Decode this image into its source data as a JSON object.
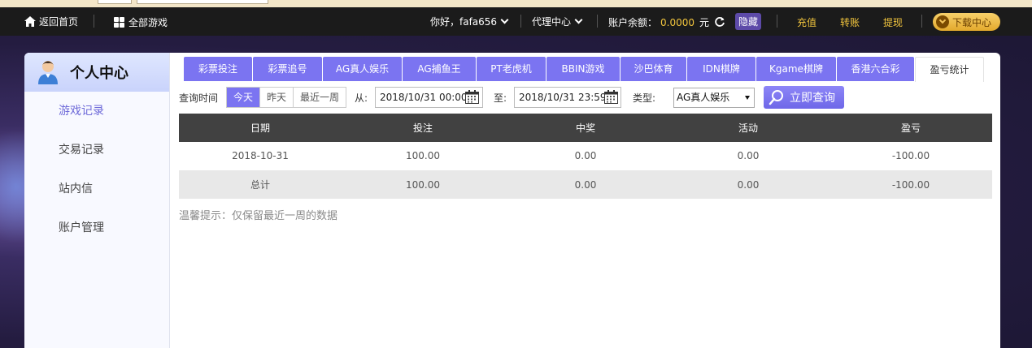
{
  "header": {
    "home_label": "返回首页",
    "all_games_label": "全部游戏",
    "greeting": "你好，fafa656",
    "agent_center": "代理中心",
    "balance_label": "账户余额：",
    "balance_value": "0.0000",
    "currency": "元",
    "hide_label": "隐藏",
    "deposit": "充值",
    "transfer": "转账",
    "withdraw": "提现",
    "download_center": "下载中心"
  },
  "sidebar": {
    "title": "个人中心",
    "items": [
      {
        "label": "游戏记录",
        "active": true
      },
      {
        "label": "交易记录",
        "active": false
      },
      {
        "label": "站内信",
        "active": false
      },
      {
        "label": "账户管理",
        "active": false
      }
    ]
  },
  "tabs": [
    {
      "label": "彩票投注"
    },
    {
      "label": "彩票追号"
    },
    {
      "label": "AG真人娱乐"
    },
    {
      "label": "AG捕鱼王"
    },
    {
      "label": "PT老虎机"
    },
    {
      "label": "BBIN游戏"
    },
    {
      "label": "沙巴体育"
    },
    {
      "label": "IDN棋牌"
    },
    {
      "label": "Kgame棋牌"
    },
    {
      "label": "香港六合彩"
    },
    {
      "label": "盈亏统计",
      "active": true
    }
  ],
  "query": {
    "time_label": "查询时间",
    "periods": [
      "今天",
      "昨天",
      "最近一周"
    ],
    "selected_period": "今天",
    "from_label": "从:",
    "from_value": "2018/10/31 00:00",
    "to_label": "至:",
    "to_value": "2018/10/31 23:59",
    "type_label": "类型:",
    "type_value": "AG真人娱乐",
    "search_button": "立即查询"
  },
  "table": {
    "columns": [
      "日期",
      "投注",
      "中奖",
      "活动",
      "盈亏"
    ],
    "rows": [
      [
        "2018-10-31",
        "100.00",
        "0.00",
        "0.00",
        "-100.00"
      ]
    ],
    "total": [
      "总计",
      "100.00",
      "0.00",
      "0.00",
      "-100.00"
    ]
  },
  "tip": "温馨提示：仅保留最近一周的数据",
  "colors": {
    "accent": "#7b74f1",
    "gold": "#f2c53d",
    "header_bg": "#1b1b1b",
    "table_header": "#414141"
  }
}
